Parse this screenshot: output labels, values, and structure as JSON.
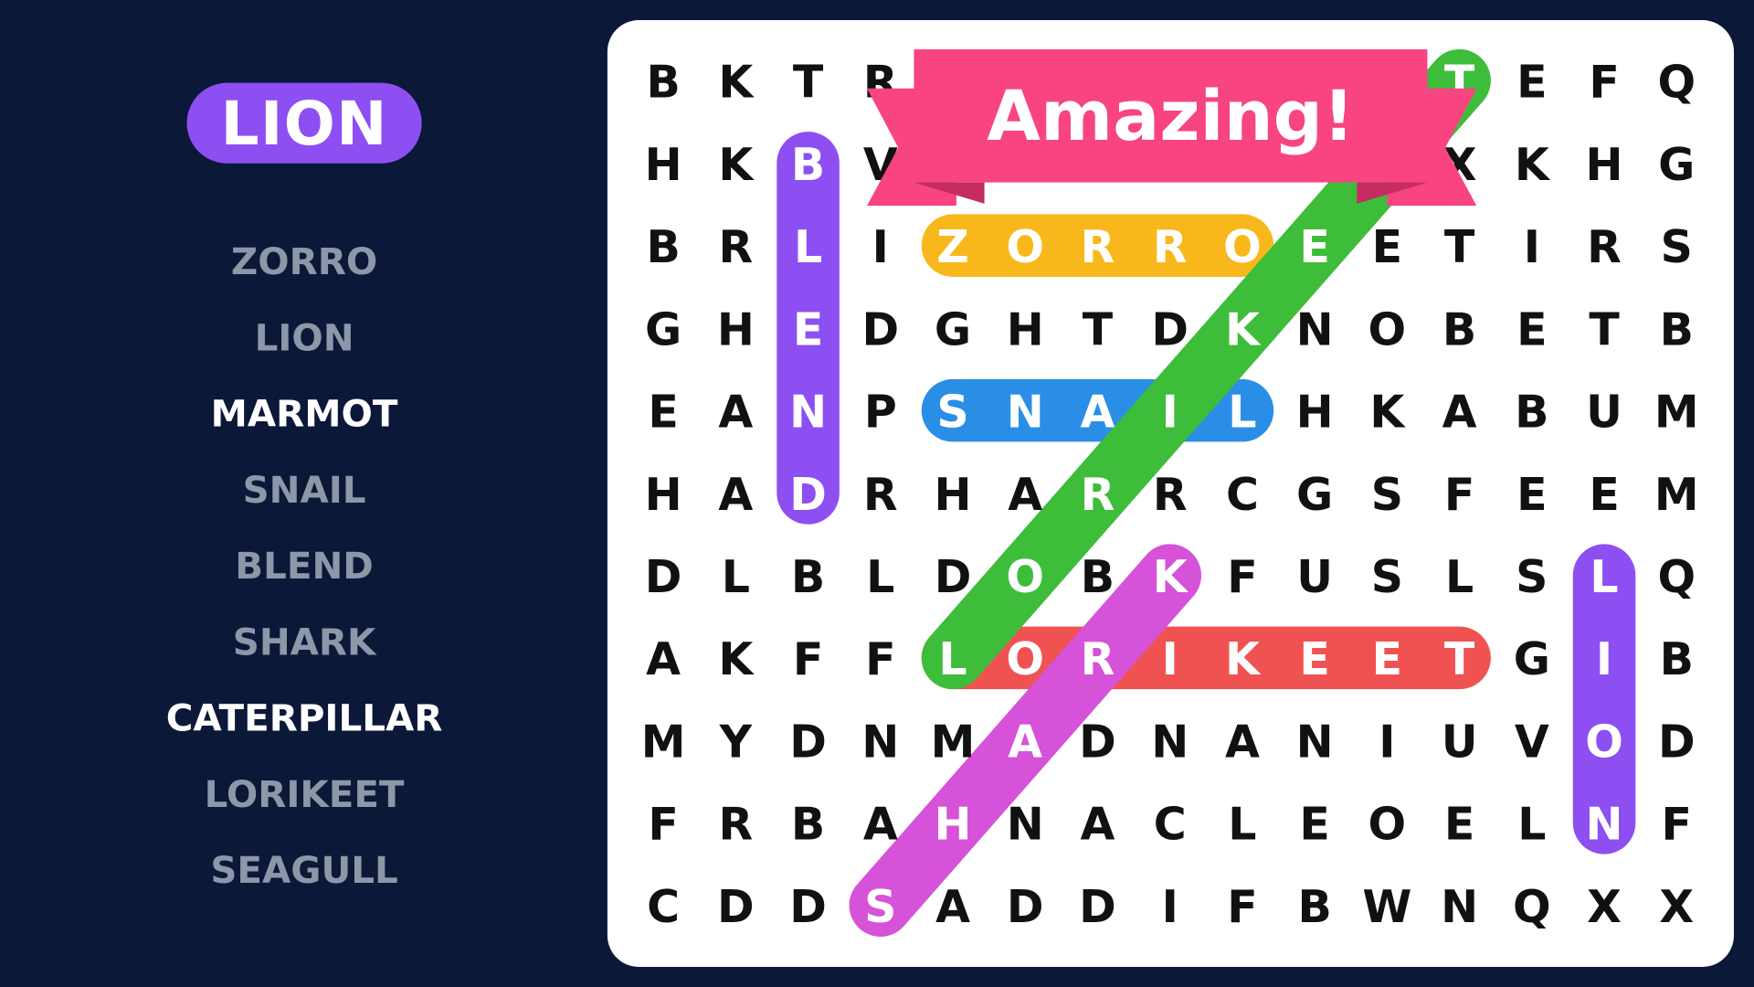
{
  "current_word": "LION",
  "banner_text": "Amazing!",
  "word_list": [
    {
      "word": "ZORRO",
      "found": true
    },
    {
      "word": "LION",
      "found": true
    },
    {
      "word": "MARMOT",
      "found": false
    },
    {
      "word": "SNAIL",
      "found": true
    },
    {
      "word": "BLEND",
      "found": true
    },
    {
      "word": "SHARK",
      "found": true
    },
    {
      "word": "CATERPILLAR",
      "found": false
    },
    {
      "word": "LORIKEET",
      "found": true
    },
    {
      "word": "SEAGULL",
      "found": true
    }
  ],
  "grid": [
    [
      "B",
      "K",
      "T",
      "R",
      "",
      "",
      "",
      "",
      "",
      "",
      "",
      "T",
      "E",
      "F",
      "Q"
    ],
    [
      "H",
      "K",
      "B",
      "V",
      "",
      "",
      "",
      "",
      "",
      "",
      "",
      "X",
      "K",
      "H",
      "G"
    ],
    [
      "B",
      "R",
      "L",
      "I",
      "Z",
      "O",
      "R",
      "R",
      "O",
      "E",
      "E",
      "T",
      "I",
      "R",
      "S"
    ],
    [
      "G",
      "H",
      "E",
      "D",
      "G",
      "H",
      "T",
      "D",
      "K",
      "N",
      "O",
      "B",
      "E",
      "T",
      "B"
    ],
    [
      "E",
      "A",
      "N",
      "P",
      "S",
      "N",
      "A",
      "I",
      "L",
      "H",
      "K",
      "A",
      "B",
      "U",
      "M"
    ],
    [
      "H",
      "A",
      "D",
      "R",
      "H",
      "A",
      "R",
      "R",
      "C",
      "G",
      "S",
      "F",
      "E",
      "E",
      "M"
    ],
    [
      "D",
      "L",
      "B",
      "L",
      "D",
      "O",
      "B",
      "K",
      "F",
      "U",
      "S",
      "L",
      "S",
      "L",
      "Q"
    ],
    [
      "A",
      "K",
      "F",
      "F",
      "L",
      "O",
      "R",
      "I",
      "K",
      "E",
      "E",
      "T",
      "G",
      "I",
      "B"
    ],
    [
      "M",
      "Y",
      "D",
      "N",
      "M",
      "A",
      "D",
      "N",
      "A",
      "N",
      "I",
      "U",
      "V",
      "O",
      "D"
    ],
    [
      "F",
      "R",
      "B",
      "A",
      "H",
      "N",
      "A",
      "C",
      "L",
      "E",
      "O",
      "E",
      "L",
      "N",
      "F"
    ],
    [
      "C",
      "D",
      "D",
      "S",
      "A",
      "D",
      "D",
      "I",
      "F",
      "B",
      "W",
      "N",
      "Q",
      "X",
      "X"
    ]
  ],
  "highlights": [
    {
      "word": "BLEND",
      "start": [
        1,
        2
      ],
      "end": [
        5,
        2
      ],
      "color": "#8d4ff2"
    },
    {
      "word": "ZORRO",
      "start": [
        2,
        4
      ],
      "end": [
        2,
        8
      ],
      "color": "#f8b81c"
    },
    {
      "word": "SNAIL",
      "start": [
        4,
        4
      ],
      "end": [
        4,
        8
      ],
      "color": "#2b8ee6"
    },
    {
      "word": "LORIKEET",
      "start": [
        7,
        4
      ],
      "end": [
        7,
        11
      ],
      "color": "#f05252"
    },
    {
      "word": "SHARK",
      "start": [
        10,
        3
      ],
      "end": [
        6,
        7
      ],
      "color": "#d652d8"
    },
    {
      "word": "",
      "start": [
        7,
        4
      ],
      "end": [
        0,
        11
      ],
      "color": "#3dbd3a"
    },
    {
      "word": "LION",
      "start": [
        6,
        13
      ],
      "end": [
        9,
        13
      ],
      "color": "#8d4ff2"
    }
  ],
  "colors": {
    "background": "#0b1838",
    "banner": "#f84480",
    "banner_fold": "#c42c62",
    "found_word": "#8d97a8",
    "open_word": "#ffffff"
  }
}
